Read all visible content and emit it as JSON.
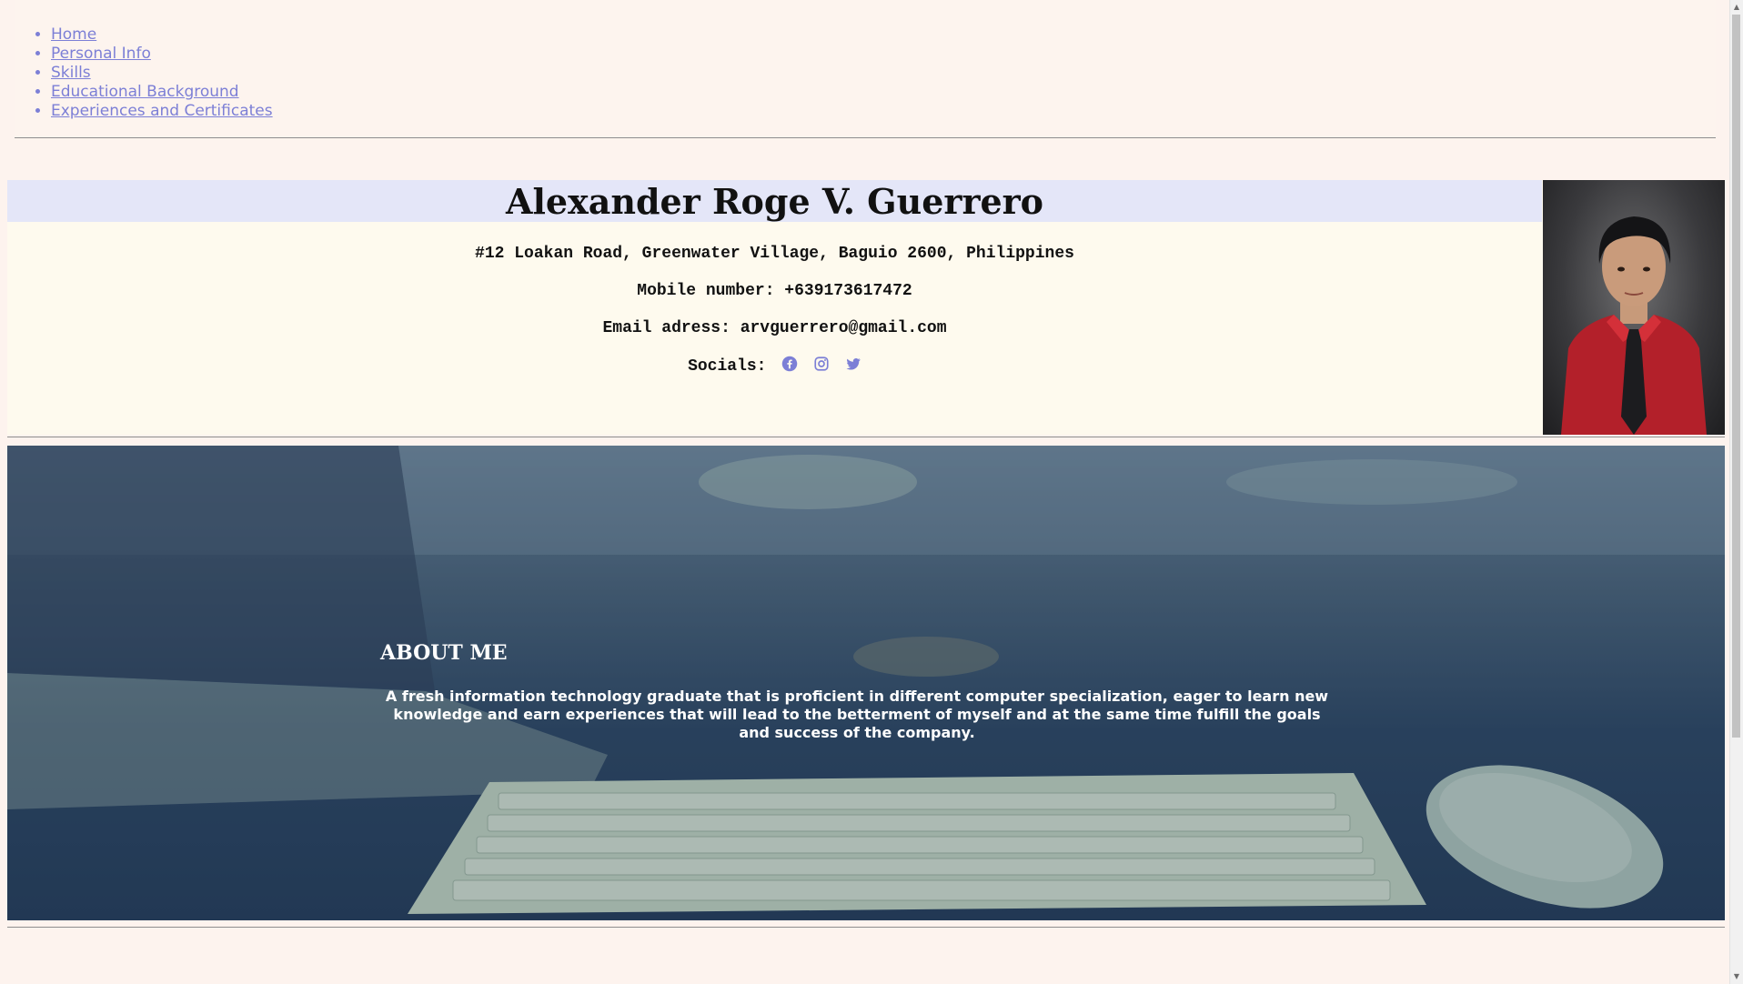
{
  "nav": {
    "items": [
      {
        "label": "Home"
      },
      {
        "label": "Personal Info"
      },
      {
        "label": "Skills"
      },
      {
        "label": "Educational Background"
      },
      {
        "label": "Experiences and Certificates"
      }
    ]
  },
  "personal": {
    "name": "Alexander Roge V. Guerrero",
    "address": "#12 Loakan Road, Greenwater Village, Baguio 2600, Philippines",
    "mobile": "Mobile number: +639173617472",
    "email": "Email adress: arvguerrero@gmail.com",
    "socials_label": "Socials:",
    "social_icons": [
      "facebook-icon",
      "instagram-icon",
      "twitter-icon"
    ]
  },
  "about": {
    "title": "ABOUT ME",
    "text": "A fresh information technology graduate that is proficient in different computer specialization, eager to learn new knowledge and earn experiences that will lead to the betterment of myself and at the same time fulfill the goals and success of the company."
  },
  "colors": {
    "page_bg": "#fdf3ee",
    "link": "#7c7fd6",
    "name_bar": "#e4e6f8",
    "social_icon": "#7c7fd6"
  }
}
